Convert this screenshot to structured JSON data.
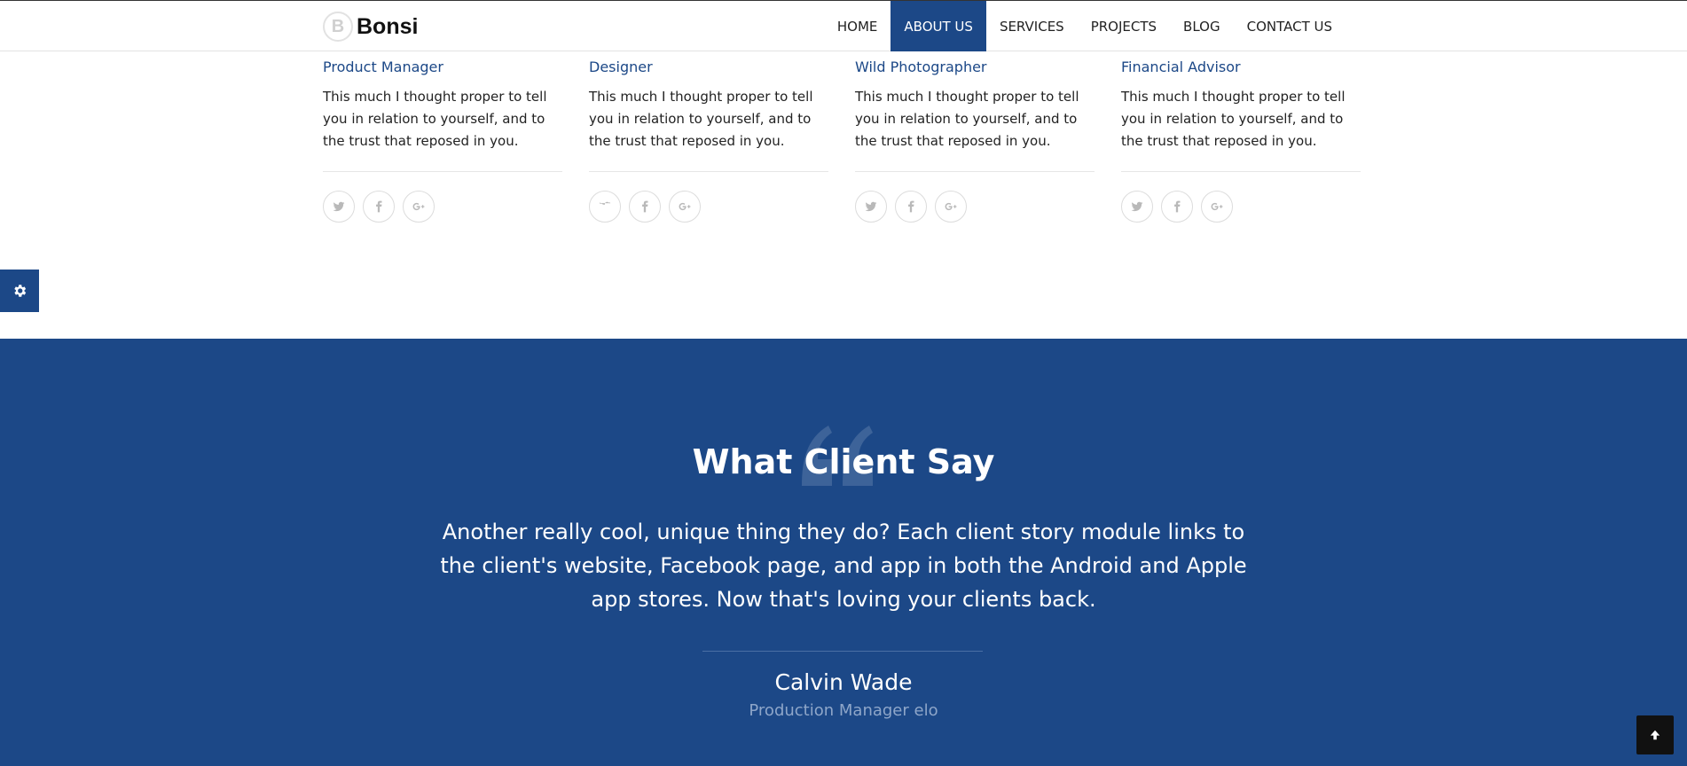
{
  "brand": {
    "logo_letter": "B",
    "name": "Bonsi"
  },
  "nav": {
    "items": [
      "HOME",
      "ABOUT US",
      "SERVICES",
      "PROJECTS",
      "BLOG",
      "CONTACT US"
    ],
    "active": "ABOUT US"
  },
  "team": {
    "members": [
      {
        "role": "Product Manager",
        "bio": "This much I thought proper to tell you in relation to yourself, and to the trust that reposed in you."
      },
      {
        "role": "Designer",
        "bio": "This much I thought proper to tell you in relation to yourself, and to the trust that reposed in you."
      },
      {
        "role": "Wild Photographer",
        "bio": "This much I thought proper to tell you in relation to yourself, and to the trust that reposed in you."
      },
      {
        "role": "Financial Advisor",
        "bio": "This much I thought proper to tell you in relation to yourself, and to the trust that reposed in you."
      }
    ],
    "social_icons": [
      "twitter-icon",
      "facebook-icon",
      "google-plus-icon"
    ]
  },
  "testimonial": {
    "title": "What Client Say",
    "text": "Another really cool, unique thing they do? Each client story module links to the client's website, Facebook page, and app in both the Android and Apple app stores. Now that's loving your clients back.",
    "client_name": "Calvin Wade",
    "client_role": "Production Manager elo"
  },
  "colors": {
    "accent": "#1c4887",
    "muted_text": "#8ea6c9",
    "icon_gray": "#b9b9b9"
  },
  "icons": {
    "settings": "gear-icon",
    "back_to_top": "arrow-up-icon",
    "quote": "quote-icon"
  }
}
